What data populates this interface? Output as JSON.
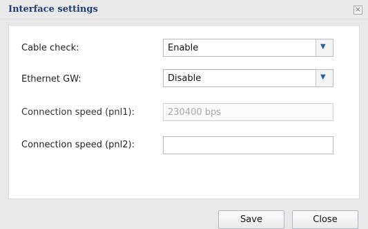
{
  "dialog": {
    "title": "Interface settings",
    "close_glyph": "×"
  },
  "fields": [
    {
      "label": "Cable check:",
      "value": "Enable",
      "type": "select",
      "arrow_icon": "chevron-down-icon"
    },
    {
      "label": "Ethernet GW:",
      "value": "Disable",
      "type": "select",
      "arrow_icon": "chevron-down-icon"
    },
    {
      "label": "Connection speed (pnl1):",
      "value": "230400 bps",
      "type": "text",
      "state": "disabled"
    },
    {
      "label": "Connection speed (pnl2):",
      "value": "",
      "type": "text",
      "state": "enabled"
    }
  ],
  "buttons": {
    "save": "Save",
    "close": "Close"
  },
  "colors": {
    "title": "#1f3f77",
    "background": "#e8e8e8",
    "select_arrow": "#2d5f9a"
  }
}
